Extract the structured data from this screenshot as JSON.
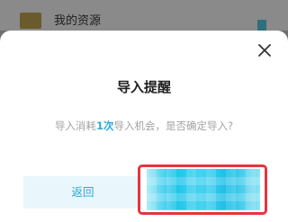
{
  "background": {
    "folder_title": "我的资源",
    "folder_icon": "folder-icon"
  },
  "dialog": {
    "title": "导入提醒",
    "message_prefix": "导入消耗",
    "message_highlight": "1次",
    "message_suffix": "导入机会，是否确定导入?",
    "close_icon": "close-icon",
    "back_label": "返回",
    "confirm_label": ""
  },
  "colors": {
    "accent": "#2aa9dc",
    "annotation": "#e5353f"
  }
}
